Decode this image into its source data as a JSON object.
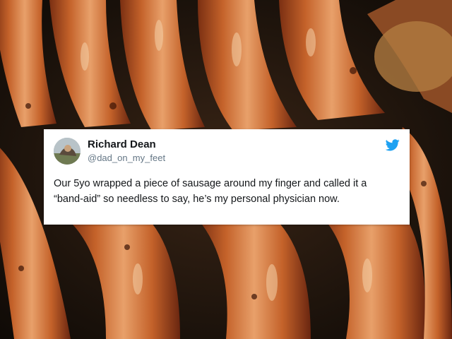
{
  "tweet": {
    "display_name": "Richard Dean",
    "handle": "@dad_on_my_feet",
    "text": "Our 5yo wrapped a piece of sausage around my finger and called it a “band-aid” so needless to say, he’s my personal physician now.",
    "brand_icon": "twitter-bird-icon",
    "brand_color": "#1da1f2"
  },
  "background": {
    "subject": "grilled sausages",
    "accent_colors": [
      "#c4622a",
      "#e8a06a",
      "#7a2f12"
    ]
  }
}
